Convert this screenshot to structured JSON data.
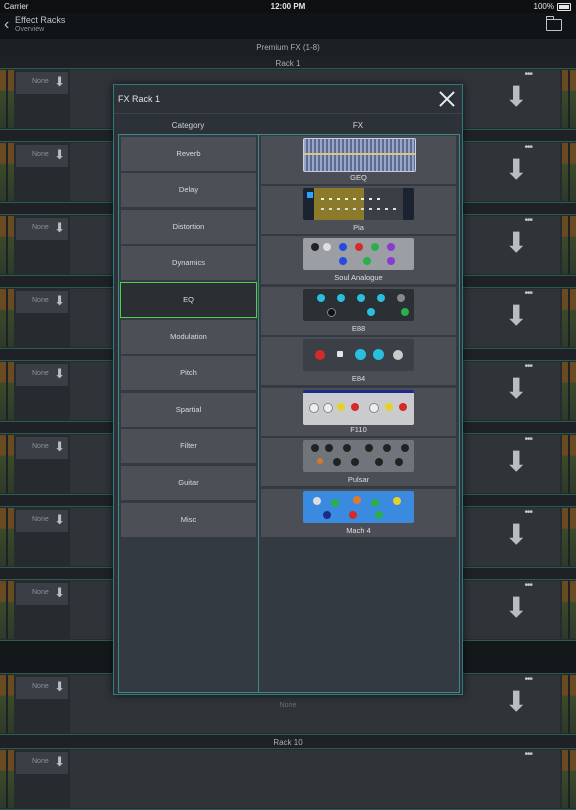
{
  "status": {
    "carrier": "Carrier",
    "time": "12:00 PM",
    "battery": "100%"
  },
  "nav": {
    "back": "‹",
    "title": "Effect Racks",
    "subtitle": "Overview"
  },
  "main": {
    "section_title": "Premium FX (1-8)",
    "rack1_label": "Rack 1",
    "rack10_label": "Rack 10",
    "slot_none": "None",
    "more": "•••",
    "panel_none": "None"
  },
  "modal": {
    "title": "FX Rack 1",
    "category_header": "Category",
    "fx_header": "FX",
    "categories": [
      "Reverb",
      "Delay",
      "Distortion",
      "Dynamics",
      "EQ",
      "Modulation",
      "Pitch",
      "Spartial",
      "Filter",
      "Guitar",
      "Misc"
    ],
    "selected_category": "EQ",
    "fx": [
      "GEQ",
      "Pia",
      "Soul Analogue",
      "E88",
      "E84",
      "F110",
      "Pulsar",
      "Mach 4"
    ]
  }
}
